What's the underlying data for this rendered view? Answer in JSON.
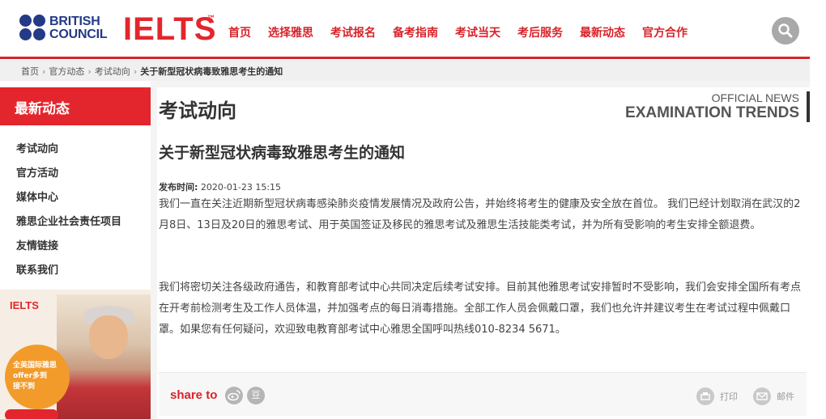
{
  "header": {
    "brand_line1": "BRITISH",
    "brand_line2": "COUNCIL",
    "ielts_logo": "IELTS",
    "ielts_tm": "™",
    "nav": [
      "首页",
      "选择雅思",
      "考试报名",
      "备考指南",
      "考试当天",
      "考后服务",
      "最新动态",
      "官方合作"
    ],
    "search_icon": "search-icon",
    "accent_color": "#d8232a"
  },
  "breadcrumb": [
    "首页",
    "官方动态",
    "考试动向",
    "关于新型冠状病毒致雅思考生的通知"
  ],
  "sidebar": {
    "title": "最新动态",
    "items": [
      "考试动向",
      "官方活动",
      "媒体中心",
      "雅思企业社会责任项目",
      "友情链接",
      "联系我们"
    ],
    "ad": {
      "logo": "IELTS",
      "bubble_lines": [
        "全英国际雅思",
        "offer多到",
        "接不到"
      ]
    }
  },
  "main": {
    "section_title": "考试动向",
    "official_top": "OFFICIAL NEWS",
    "official_bottom": "EXAMINATION TRENDS",
    "article_title": "关于新型冠状病毒致雅思考生的通知",
    "pub_label": "发布时间:",
    "pub_date": "2020-01-23 15:15",
    "paragraph1": "我们一直在关注近期新型冠状病毒感染肺炎疫情发展情况及政府公告，并始终将考生的健康及安全放在首位。 我们已经计划取消在武汉的2月8日、13日及20日的雅思考试、用于英国签证及移民的雅思考试及雅思生活技能类考试，并为所有受影响的考生安排全额退费。",
    "paragraph2": "我们将密切关注各级政府通告，和教育部考试中心共同决定后续考试安排。目前其他雅思考试安排暂时不受影响，我们会安排全国所有考点在开考前检测考生及工作人员体温，并加强考点的每日消毒措施。全部工作人员会佩戴口罩，我们也允许并建议考生在考试过程中佩戴口罩。如果您有任何疑问，欢迎致电教育部考试中心雅思全国呼叫热线010-8234 5671。"
  },
  "share": {
    "label": "share to",
    "weibo_icon": "weibo-icon",
    "douban_glyph": "豆",
    "print_label": "打印",
    "email_label": "邮件"
  }
}
